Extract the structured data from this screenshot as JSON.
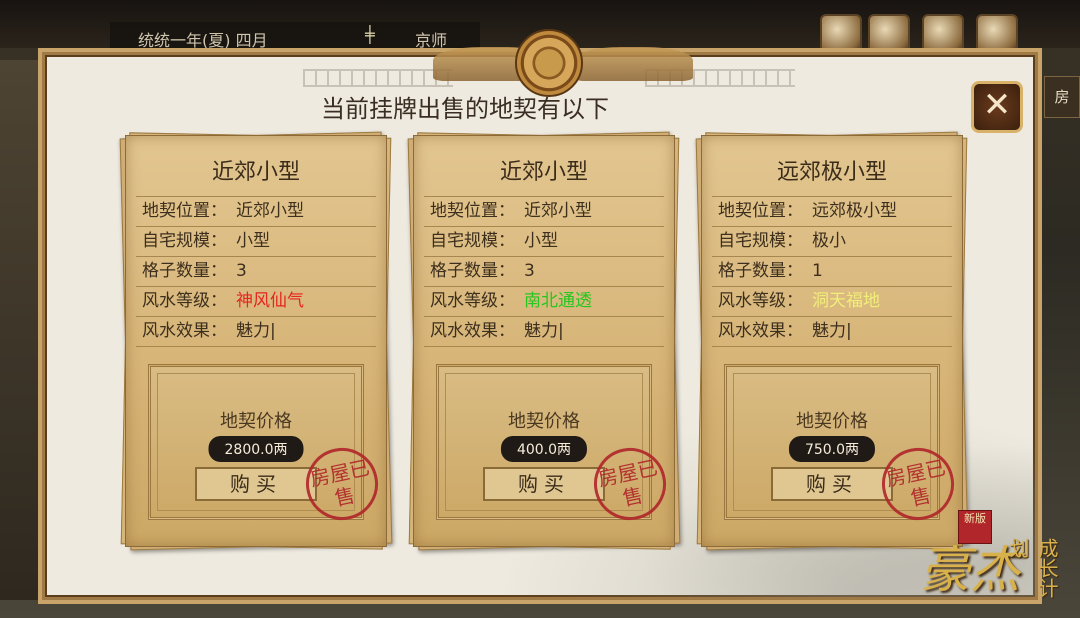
{
  "top_bar": {
    "date": "统统一年(夏) 四月",
    "location": "京师",
    "right_tab": "房"
  },
  "panel": {
    "headline": "当前挂牌出售的地契有以下",
    "close_symbol": "✕"
  },
  "cards": [
    {
      "title": "近郊小型",
      "rows": [
        {
          "key": "地契位置：",
          "value": "近郊小型"
        },
        {
          "key": "自宅规模：",
          "value": "小型"
        },
        {
          "key": "格子数量：",
          "value": "3"
        },
        {
          "key": "风水等级：",
          "value": "神风仙气",
          "color": "#e5251f"
        },
        {
          "key": "风水效果：",
          "value": "魅力|"
        }
      ],
      "price_label": "地契价格",
      "price": "2800.0两",
      "buy_label": "购买",
      "stamp_text": "房屋已售"
    },
    {
      "title": "近郊小型",
      "rows": [
        {
          "key": "地契位置：",
          "value": "近郊小型"
        },
        {
          "key": "自宅规模：",
          "value": "小型"
        },
        {
          "key": "格子数量：",
          "value": "3"
        },
        {
          "key": "风水等级：",
          "value": "南北通透",
          "color": "#26c71e"
        },
        {
          "key": "风水效果：",
          "value": "魅力|"
        }
      ],
      "price_label": "地契价格",
      "price": "400.0两",
      "buy_label": "购买",
      "stamp_text": "房屋已售"
    },
    {
      "title": "远郊极小型",
      "rows": [
        {
          "key": "地契位置：",
          "value": "远郊极小型"
        },
        {
          "key": "自宅规模：",
          "value": "极小"
        },
        {
          "key": "格子数量：",
          "value": "1"
        },
        {
          "key": "风水等级：",
          "value": "洞天福地",
          "color": "#f1ee7a"
        },
        {
          "key": "风水效果：",
          "value": "魅力|"
        }
      ],
      "price_label": "地契价格",
      "price": "750.0两",
      "buy_label": "购买",
      "stamp_text": "房屋已售"
    }
  ],
  "logo": {
    "main": "豪杰",
    "sub": "成长计划",
    "seal": "新版"
  }
}
